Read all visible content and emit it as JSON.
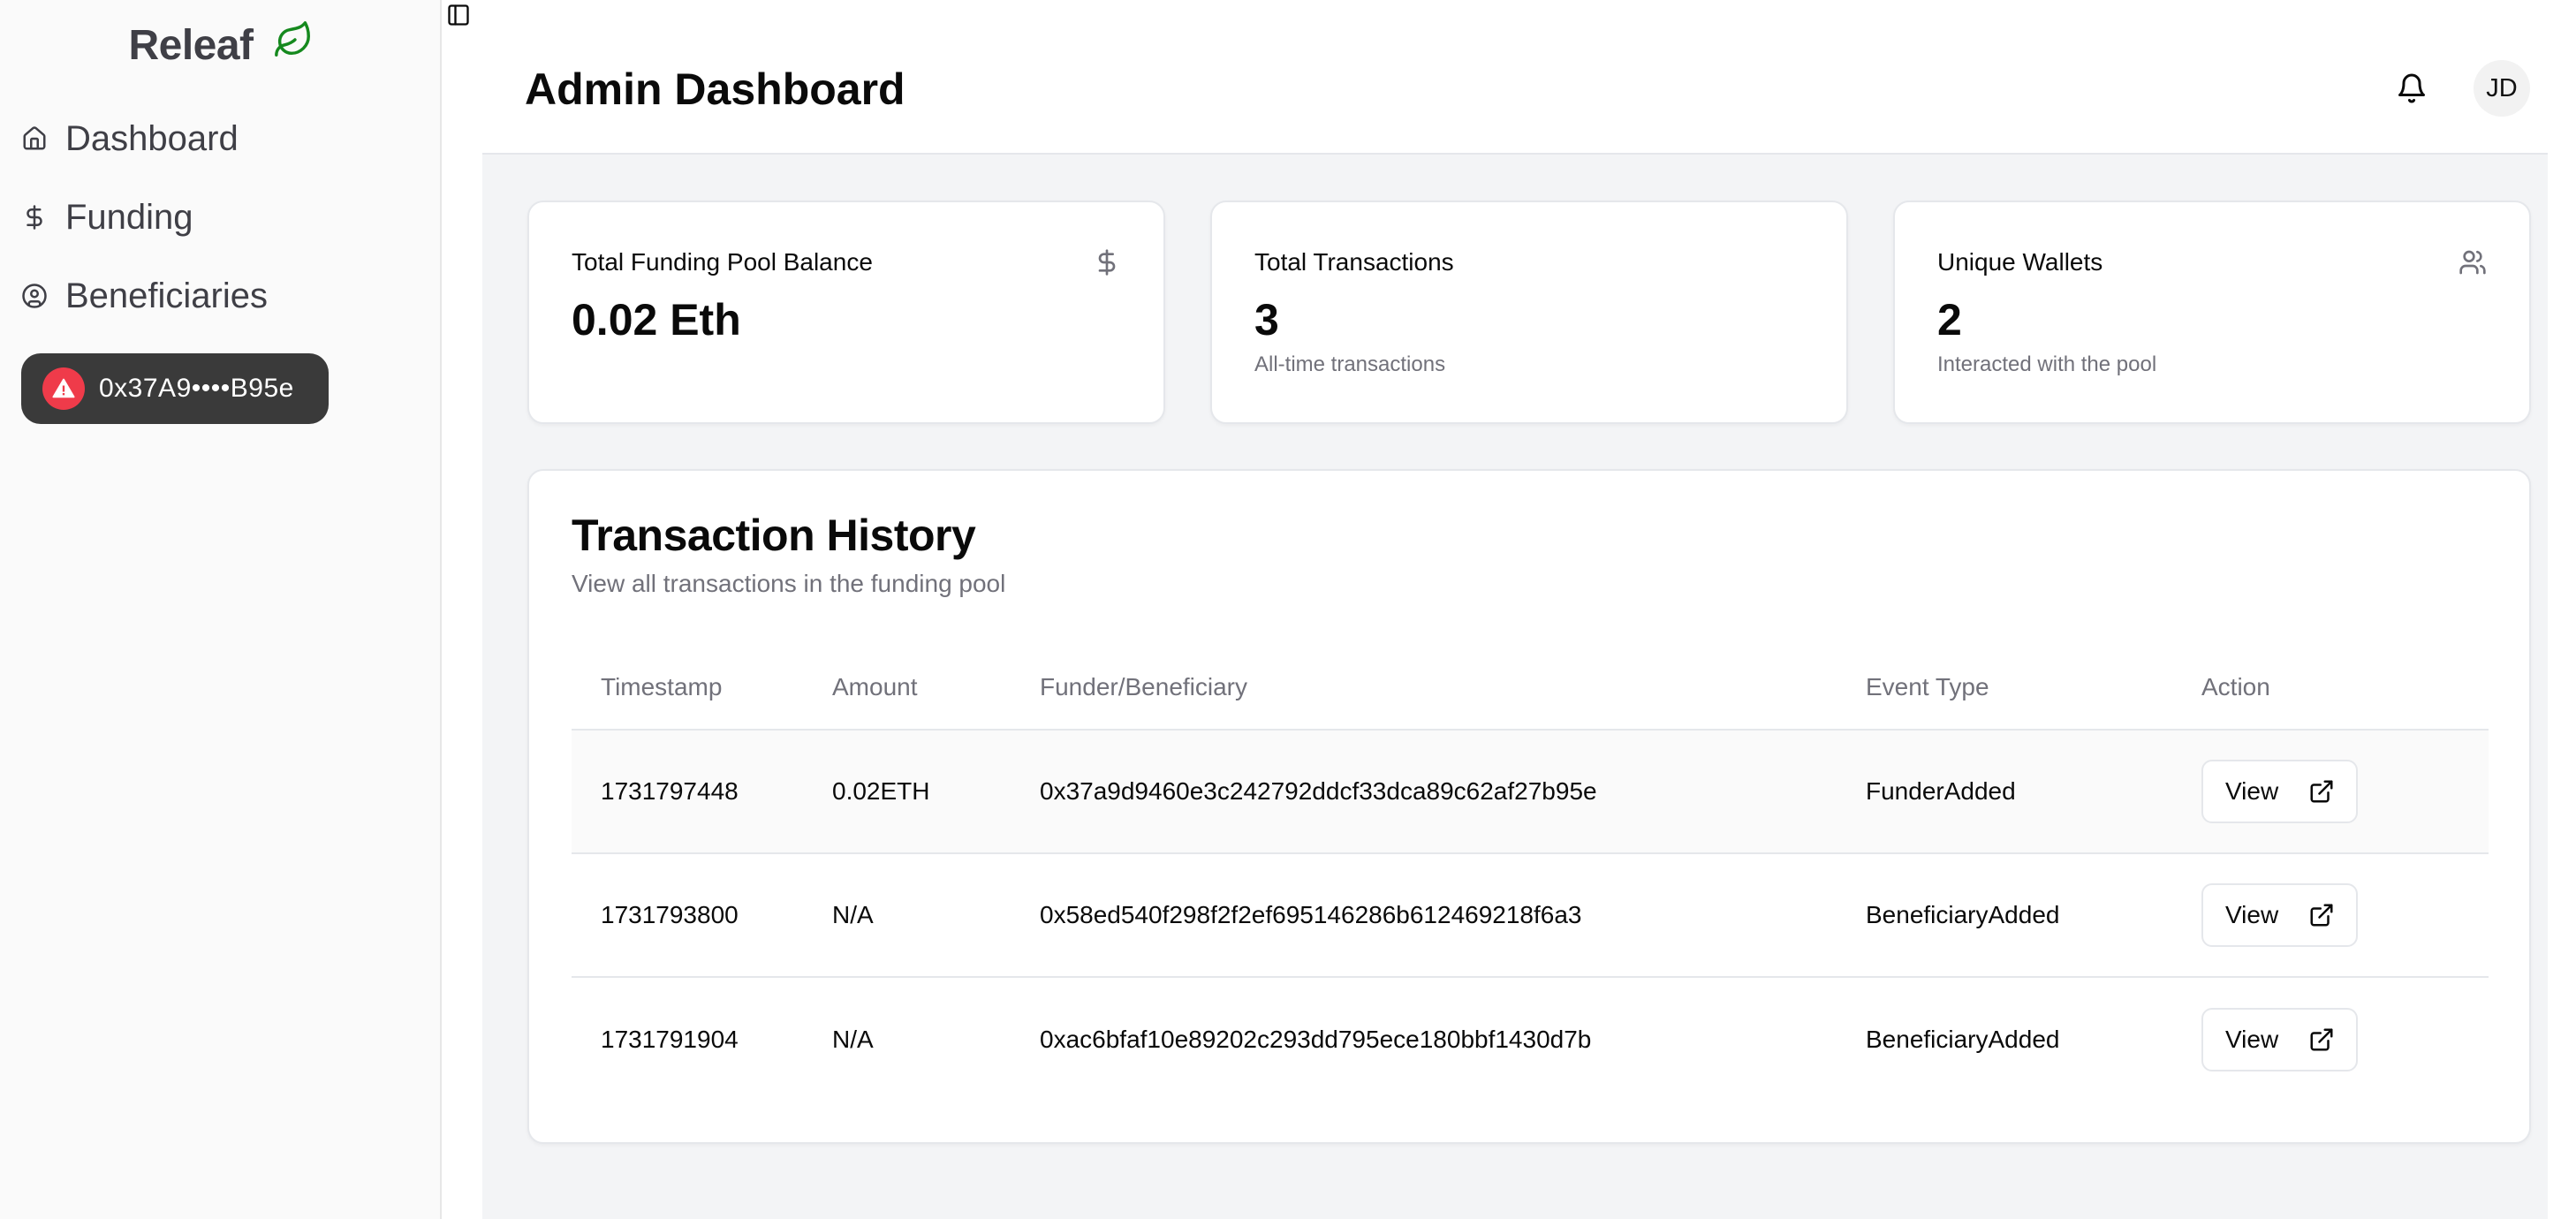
{
  "sidebar": {
    "brand": "Releaf",
    "brand_icon": "leaf-icon",
    "items": [
      {
        "label": "Dashboard",
        "icon": "home-icon"
      },
      {
        "label": "Funding",
        "icon": "dollar-icon"
      },
      {
        "label": "Beneficiaries",
        "icon": "user-circle-icon"
      }
    ],
    "wallet": {
      "address": "0x37A9••••B95e",
      "status_icon": "warning-icon",
      "status_color": "#ef3b4a"
    }
  },
  "header": {
    "toggle_icon": "sidebar-toggle-icon",
    "title": "Admin Dashboard",
    "notification_icon": "bell-icon",
    "avatar_initials": "JD"
  },
  "stats": [
    {
      "label": "Total Funding Pool Balance",
      "value": "0.02 Eth",
      "sub": "",
      "icon": "dollar-icon"
    },
    {
      "label": "Total Transactions",
      "value": "3",
      "sub": "All-time transactions",
      "icon": ""
    },
    {
      "label": "Unique Wallets",
      "value": "2",
      "sub": "Interacted with the pool",
      "icon": "users-icon"
    }
  ],
  "transactions": {
    "title": "Transaction History",
    "subtitle": "View all transactions in the funding pool",
    "columns": [
      "Timestamp",
      "Amount",
      "Funder/Beneficiary",
      "Event Type",
      "Action"
    ],
    "rows": [
      {
        "timestamp": "1731797448",
        "amount": "0.02ETH",
        "address": "0x37a9d9460e3c242792ddcf33dca89c62af27b95e",
        "event": "FunderAdded",
        "action": "View"
      },
      {
        "timestamp": "1731793800",
        "amount": "N/A",
        "address": "0x58ed540f298f2f2ef695146286b612469218f6a3",
        "event": "BeneficiaryAdded",
        "action": "View"
      },
      {
        "timestamp": "1731791904",
        "amount": "N/A",
        "address": "0xac6bfaf10e89202c293dd795ece180bbf1430d7b",
        "event": "BeneficiaryAdded",
        "action": "View"
      }
    ]
  },
  "colors": {
    "brand_green": "#15891e",
    "wallet_bg": "#3a3a3a",
    "alert_red": "#ef3b4a",
    "main_bg": "#f3f4f6"
  }
}
